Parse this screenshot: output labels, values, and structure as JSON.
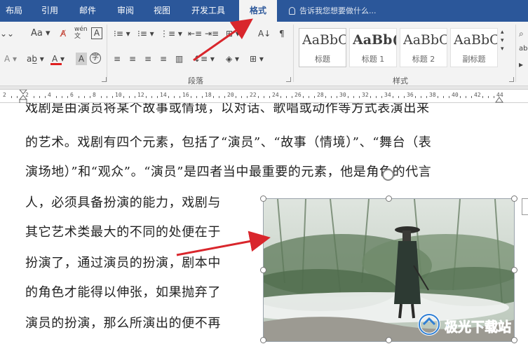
{
  "tabs": [
    {
      "label": "布局"
    },
    {
      "label": "引用"
    },
    {
      "label": "邮件"
    },
    {
      "label": "审阅"
    },
    {
      "label": "视图"
    },
    {
      "label": "开发工具"
    },
    {
      "label": "格式"
    }
  ],
  "tell_me": "告诉我您想要做什么...",
  "ribbon": {
    "font_size_glyph": "Aa",
    "wen": "wén",
    "paragraph_group": "段落",
    "styles_group": "样式",
    "styles": [
      {
        "sample": "AaBbC",
        "name": "标题"
      },
      {
        "sample": "AaBb(",
        "name": "标题 1"
      },
      {
        "sample": "AaBbC",
        "name": "标题 2"
      },
      {
        "sample": "AaBbC",
        "name": "副标题"
      }
    ]
  },
  "ruler": {
    "ticks": [
      "2",
      "2",
      "4",
      "6",
      "8",
      "10",
      "12",
      "14",
      "16",
      "18",
      "20",
      "22",
      "24",
      "26",
      "28",
      "30",
      "32",
      "34",
      "36",
      "38",
      "40",
      "42",
      "44"
    ]
  },
  "document": {
    "lines_full": [
      "戏剧是由演员将某个故事或情境，以对话、歌唱或动作等方式表演出来",
      "的艺术。戏剧有四个元素，包括了“演员”、“故事（情境）”、“舞台（表",
      "演场地）”和“观众”。“演员”是四者当中最重要的元素，他是角色的代言"
    ],
    "lines_wrapped": [
      "人，必须具备扮演的能力，戏剧与",
      "其它艺术类最大的不同的处便在于",
      "扮演了，通过演员的扮演，剧本中",
      "的角色才能得以伸张，如果抛弃了",
      "演员的扮演，那么所演出的便不再"
    ]
  },
  "watermark": "极光下载站",
  "colors": {
    "tab_bar": "#2b579a",
    "arrow": "#d9262c",
    "font_color_bar": "#e02020"
  }
}
